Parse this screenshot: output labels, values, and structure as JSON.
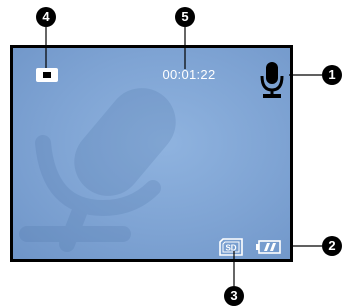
{
  "screen": {
    "mode_icon": "stop-square-icon",
    "elapsed_time": "00:01:22",
    "audio_icon": "microphone-icon",
    "storage_icon": "sd-card-icon",
    "storage_label": "SD",
    "battery_icon": "battery-icon",
    "background_color": "#7ea3d3",
    "watermark_icon": "microphone-watermark-icon"
  },
  "callouts": {
    "c1": "1",
    "c2": "2",
    "c3": "3",
    "c4": "4",
    "c5": "5"
  }
}
